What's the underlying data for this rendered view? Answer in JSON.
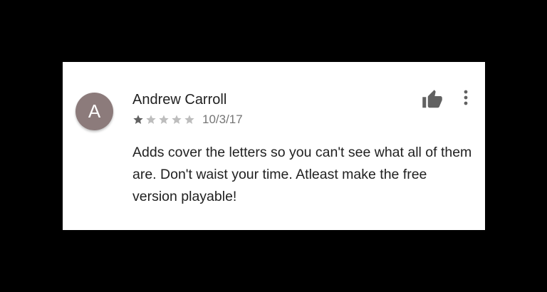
{
  "review": {
    "avatar_letter": "A",
    "avatar_color": "#8c7b7b",
    "author": "Andrew Carroll",
    "rating": 1,
    "rating_max": 5,
    "date": "10/3/17",
    "text": "Adds cover the letters so you can't see what all of them are. Don't waist your time. Atleast make the free version playable!"
  },
  "icons": {
    "helpful": "thumbs-up-icon",
    "menu": "more-vert-icon",
    "star_filled_color": "#616161",
    "star_empty_color": "#bdbdbd"
  }
}
